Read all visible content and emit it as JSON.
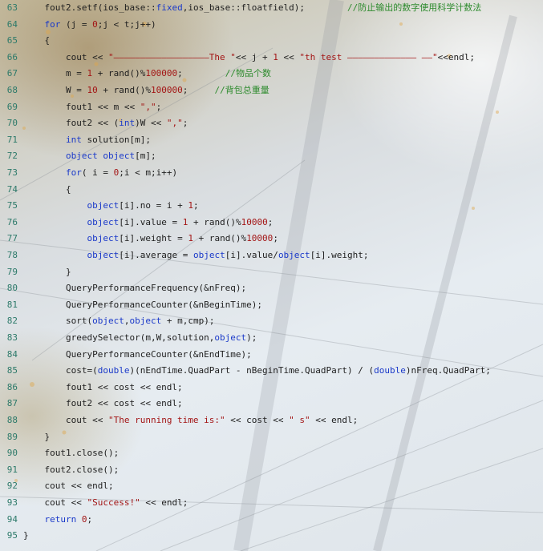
{
  "colors": {
    "keyword": "#1a39c9",
    "string": "#a31515",
    "comment": "#2e8b2e",
    "line_number": "#2d7a6a",
    "text": "#1e1e1e"
  },
  "lines": [
    {
      "n": "63",
      "tokens": [
        {
          "t": "txt",
          "v": "    fout2.setf(ios_base::"
        },
        {
          "t": "kw",
          "v": "fixed"
        },
        {
          "t": "txt",
          "v": ",ios_base::floatfield);        "
        },
        {
          "t": "cmt",
          "v": "//防止输出的数字使用科学计数法"
        }
      ]
    },
    {
      "n": "64",
      "tokens": [
        {
          "t": "txt",
          "v": "    "
        },
        {
          "t": "kw",
          "v": "for"
        },
        {
          "t": "txt",
          "v": " (j = "
        },
        {
          "t": "num",
          "v": "0"
        },
        {
          "t": "txt",
          "v": ";j < t;j++)"
        }
      ]
    },
    {
      "n": "65",
      "tokens": [
        {
          "t": "txt",
          "v": "    {"
        }
      ]
    },
    {
      "n": "66",
      "tokens": [
        {
          "t": "txt",
          "v": "        cout << "
        },
        {
          "t": "str",
          "v": "\"——————————————————The \""
        },
        {
          "t": "txt",
          "v": "<< j + "
        },
        {
          "t": "num",
          "v": "1"
        },
        {
          "t": "txt",
          "v": " << "
        },
        {
          "t": "str",
          "v": "\"th test ————————————— ——\""
        },
        {
          "t": "txt",
          "v": "<<endl;"
        }
      ]
    },
    {
      "n": "67",
      "tokens": [
        {
          "t": "txt",
          "v": "        m = "
        },
        {
          "t": "num",
          "v": "1"
        },
        {
          "t": "txt",
          "v": " + rand()%"
        },
        {
          "t": "num",
          "v": "100000"
        },
        {
          "t": "txt",
          "v": ";        "
        },
        {
          "t": "cmt",
          "v": "//物品个数"
        }
      ]
    },
    {
      "n": "68",
      "tokens": [
        {
          "t": "txt",
          "v": "        W = "
        },
        {
          "t": "num",
          "v": "10"
        },
        {
          "t": "txt",
          "v": " + rand()%"
        },
        {
          "t": "num",
          "v": "100000"
        },
        {
          "t": "txt",
          "v": ";     "
        },
        {
          "t": "cmt",
          "v": "//背包总重量"
        }
      ]
    },
    {
      "n": "69",
      "tokens": [
        {
          "t": "txt",
          "v": "        fout1 << m << "
        },
        {
          "t": "str",
          "v": "\",\""
        },
        {
          "t": "txt",
          "v": ";"
        }
      ]
    },
    {
      "n": "70",
      "tokens": [
        {
          "t": "txt",
          "v": "        fout2 << ("
        },
        {
          "t": "kw",
          "v": "int"
        },
        {
          "t": "txt",
          "v": ")W << "
        },
        {
          "t": "str",
          "v": "\",\""
        },
        {
          "t": "txt",
          "v": ";"
        }
      ]
    },
    {
      "n": "71",
      "tokens": [
        {
          "t": "txt",
          "v": "        "
        },
        {
          "t": "kw",
          "v": "int"
        },
        {
          "t": "txt",
          "v": " solution[m];"
        }
      ]
    },
    {
      "n": "72",
      "tokens": [
        {
          "t": "txt",
          "v": "        "
        },
        {
          "t": "kw",
          "v": "object"
        },
        {
          "t": "txt",
          "v": " "
        },
        {
          "t": "kw",
          "v": "object"
        },
        {
          "t": "txt",
          "v": "[m];"
        }
      ]
    },
    {
      "n": "73",
      "tokens": [
        {
          "t": "txt",
          "v": "        "
        },
        {
          "t": "kw",
          "v": "for"
        },
        {
          "t": "txt",
          "v": "( i = "
        },
        {
          "t": "num",
          "v": "0"
        },
        {
          "t": "txt",
          "v": ";i < m;i++)"
        }
      ]
    },
    {
      "n": "74",
      "tokens": [
        {
          "t": "txt",
          "v": "        {"
        }
      ]
    },
    {
      "n": "75",
      "tokens": [
        {
          "t": "txt",
          "v": "            "
        },
        {
          "t": "kw",
          "v": "object"
        },
        {
          "t": "txt",
          "v": "[i].no = i + "
        },
        {
          "t": "num",
          "v": "1"
        },
        {
          "t": "txt",
          "v": ";"
        }
      ]
    },
    {
      "n": "76",
      "tokens": [
        {
          "t": "txt",
          "v": "            "
        },
        {
          "t": "kw",
          "v": "object"
        },
        {
          "t": "txt",
          "v": "[i].value = "
        },
        {
          "t": "num",
          "v": "1"
        },
        {
          "t": "txt",
          "v": " + rand()%"
        },
        {
          "t": "num",
          "v": "10000"
        },
        {
          "t": "txt",
          "v": ";"
        }
      ]
    },
    {
      "n": "77",
      "tokens": [
        {
          "t": "txt",
          "v": "            "
        },
        {
          "t": "kw",
          "v": "object"
        },
        {
          "t": "txt",
          "v": "[i].weight = "
        },
        {
          "t": "num",
          "v": "1"
        },
        {
          "t": "txt",
          "v": " + rand()%"
        },
        {
          "t": "num",
          "v": "10000"
        },
        {
          "t": "txt",
          "v": ";"
        }
      ]
    },
    {
      "n": "78",
      "tokens": [
        {
          "t": "txt",
          "v": "            "
        },
        {
          "t": "kw",
          "v": "object"
        },
        {
          "t": "txt",
          "v": "[i].average = "
        },
        {
          "t": "kw",
          "v": "object"
        },
        {
          "t": "txt",
          "v": "[i].value/"
        },
        {
          "t": "kw",
          "v": "object"
        },
        {
          "t": "txt",
          "v": "[i].weight;"
        }
      ]
    },
    {
      "n": "79",
      "tokens": [
        {
          "t": "txt",
          "v": "        }"
        }
      ]
    },
    {
      "n": "80",
      "tokens": [
        {
          "t": "txt",
          "v": "        QueryPerformanceFrequency(&nFreq);"
        }
      ]
    },
    {
      "n": "81",
      "tokens": [
        {
          "t": "txt",
          "v": "        QueryPerformanceCounter(&nBeginTime);"
        }
      ]
    },
    {
      "n": "82",
      "tokens": [
        {
          "t": "txt",
          "v": "        sort("
        },
        {
          "t": "kw",
          "v": "object"
        },
        {
          "t": "txt",
          "v": ","
        },
        {
          "t": "kw",
          "v": "object"
        },
        {
          "t": "txt",
          "v": " + m,cmp);"
        }
      ]
    },
    {
      "n": "83",
      "tokens": [
        {
          "t": "txt",
          "v": "        greedySelector(m,W,solution,"
        },
        {
          "t": "kw",
          "v": "object"
        },
        {
          "t": "txt",
          "v": ");"
        }
      ]
    },
    {
      "n": "84",
      "tokens": [
        {
          "t": "txt",
          "v": "        QueryPerformanceCounter(&nEndTime);"
        }
      ]
    },
    {
      "n": "85",
      "tokens": [
        {
          "t": "txt",
          "v": "        cost=("
        },
        {
          "t": "kw",
          "v": "double"
        },
        {
          "t": "txt",
          "v": ")(nEndTime.QuadPart - nBeginTime.QuadPart) / ("
        },
        {
          "t": "kw",
          "v": "double"
        },
        {
          "t": "txt",
          "v": ")nFreq.QuadPart;"
        }
      ]
    },
    {
      "n": "86",
      "tokens": [
        {
          "t": "txt",
          "v": "        fout1 << cost << endl;"
        }
      ]
    },
    {
      "n": "87",
      "tokens": [
        {
          "t": "txt",
          "v": "        fout2 << cost << endl;"
        }
      ]
    },
    {
      "n": "88",
      "tokens": [
        {
          "t": "txt",
          "v": "        cout << "
        },
        {
          "t": "str",
          "v": "\"The running time is:\""
        },
        {
          "t": "txt",
          "v": " << cost << "
        },
        {
          "t": "str",
          "v": "\" s\""
        },
        {
          "t": "txt",
          "v": " << endl;"
        }
      ]
    },
    {
      "n": "89",
      "tokens": [
        {
          "t": "txt",
          "v": "    }"
        }
      ]
    },
    {
      "n": "90",
      "tokens": [
        {
          "t": "txt",
          "v": "    fout1.close();"
        }
      ]
    },
    {
      "n": "91",
      "tokens": [
        {
          "t": "txt",
          "v": "    fout2.close();"
        }
      ]
    },
    {
      "n": "92",
      "tokens": [
        {
          "t": "txt",
          "v": "    cout << endl;"
        }
      ]
    },
    {
      "n": "93",
      "tokens": [
        {
          "t": "txt",
          "v": "    cout << "
        },
        {
          "t": "str",
          "v": "\"Success!\""
        },
        {
          "t": "txt",
          "v": " << endl;"
        }
      ]
    },
    {
      "n": "94",
      "tokens": [
        {
          "t": "txt",
          "v": "    "
        },
        {
          "t": "kw",
          "v": "return"
        },
        {
          "t": "txt",
          "v": " "
        },
        {
          "t": "num",
          "v": "0"
        },
        {
          "t": "txt",
          "v": ";"
        }
      ]
    },
    {
      "n": "95",
      "tokens": [
        {
          "t": "txt",
          "v": "}"
        }
      ]
    }
  ]
}
